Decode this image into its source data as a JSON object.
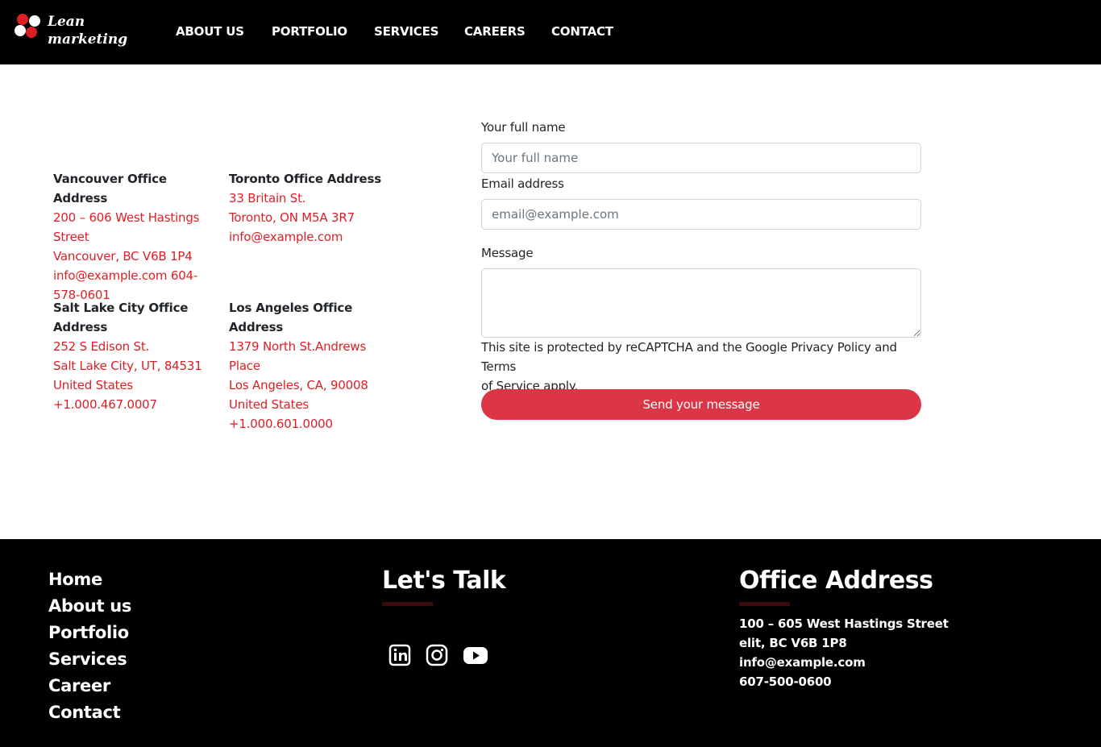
{
  "brand": {
    "line1": "Lean",
    "line2": "marketing",
    "accent": "#dc1f26"
  },
  "nav": {
    "about": "ABOUT US",
    "portfolio": "PORTFOLIO",
    "services": "SERVICES",
    "careers": "CAREERS",
    "contact": "CONTACT"
  },
  "offices": [
    {
      "title": "Vancouver Office Address",
      "lines": [
        "200 – 606 West Hastings",
        "Street",
        "Vancouver, BC V6B 1P4",
        "info@example.com 604-",
        "578-0601"
      ]
    },
    {
      "title": "Toronto Office Address",
      "lines": [
        "33 Britain St.",
        "Toronto, ON M5A 3R7",
        "info@example.com"
      ]
    },
    {
      "title_line1": "Salt Lake City Office",
      "title_line2": "Address",
      "lines": [
        "252 S Edison St.",
        "Salt Lake City, UT, 84531",
        "United States",
        "+1.000.467.0007"
      ]
    },
    {
      "title_line1": "Los Angeles Office",
      "title_line2": "Address",
      "lines": [
        "1379 North St.Andrews",
        "Place",
        "Los Angeles, CA, 90008",
        "United States",
        "+1.000.601.0000"
      ]
    }
  ],
  "form": {
    "name_label": "Your full name",
    "name_placeholder": "Your full name",
    "email_label": "Email address",
    "email_placeholder": "email@example.com",
    "message_label": "Message",
    "recaptcha_line1": "This site is protected by reCAPTCHA and the Google Privacy Policy and Terms",
    "recaptcha_line2": "of Service apply.",
    "submit": "Send your message",
    "button_color": "#dc3545"
  },
  "footer": {
    "links": [
      "Home",
      "About us",
      "Portfolio",
      "Services",
      "Career",
      "Contact"
    ],
    "talk_title": "Let's Talk",
    "social_icons": [
      "linkedin-icon",
      "instagram-icon",
      "youtube-icon"
    ],
    "address_title": "Office Address",
    "address_lines": [
      "100 – 605 West Hastings Street",
      "elit, BC V6B 1P8",
      "info@example.com",
      "607-500-0600"
    ]
  }
}
